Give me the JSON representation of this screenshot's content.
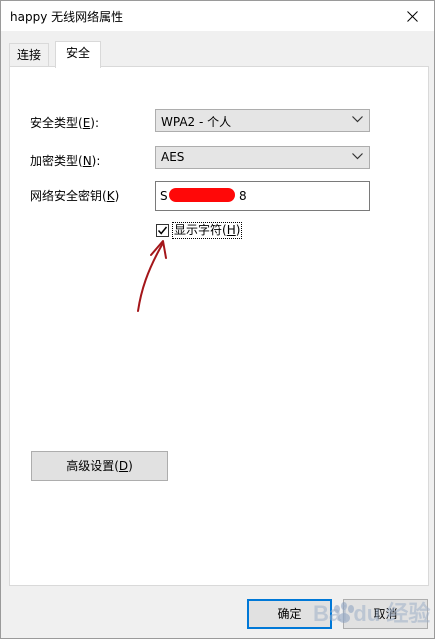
{
  "window": {
    "title": "happy 无线网络属性",
    "close_glyph": "✕"
  },
  "tabs": [
    {
      "label": "连接"
    },
    {
      "label": "安全"
    }
  ],
  "form": {
    "security_type": {
      "label_pre": "安全类型(",
      "accel": "E",
      "label_post": "):",
      "value": "WPA2 - 个人"
    },
    "encryption_type": {
      "label_pre": "加密类型(",
      "accel": "N",
      "label_post": "):",
      "value": "AES"
    },
    "network_key": {
      "label_pre": "网络安全密钥(",
      "accel": "K",
      "label_post": ")",
      "value_start": "S",
      "value_end": "8"
    },
    "show_chars": {
      "label_pre": "显示字符(",
      "accel": "H",
      "label_post": ")",
      "checked": true
    }
  },
  "buttons": {
    "advanced": {
      "label_pre": "高级设置(",
      "accel": "D",
      "label_post": ")"
    },
    "ok": "确定",
    "cancel": "取消"
  },
  "watermark": {
    "text": "Bai du 经验"
  },
  "colors": {
    "redaction": "#ff0808",
    "annotation": "#a4161a",
    "default_button_border": "#0078d7"
  }
}
